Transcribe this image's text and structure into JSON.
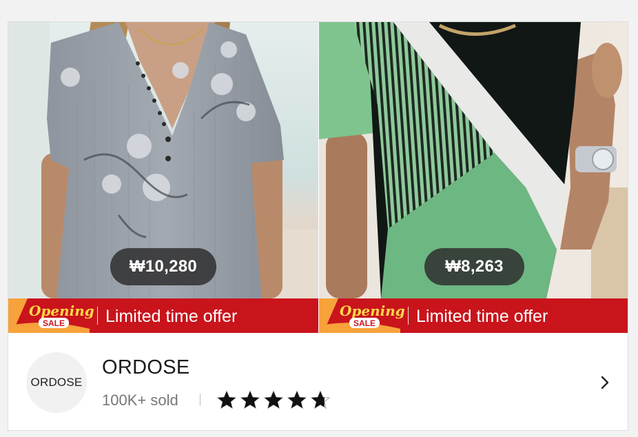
{
  "products": [
    {
      "price": "₩10,280",
      "promo_badge_line1": "Opening",
      "promo_badge_line2": "SALE",
      "promo_text": "Limited time offer"
    },
    {
      "price": "₩8,263",
      "promo_badge_line1": "Opening",
      "promo_badge_line2": "SALE",
      "promo_text": "Limited time offer"
    }
  ],
  "store": {
    "logo_text": "ORDOSE",
    "name": "ORDOSE",
    "sold": "100K+ sold",
    "rating": 4.7,
    "rating_max": 5,
    "open_icon": "chevron-right-icon"
  },
  "colors": {
    "promo_red": "#c9141c",
    "promo_orange": "#f7a23b",
    "price_pill": "#303030"
  }
}
